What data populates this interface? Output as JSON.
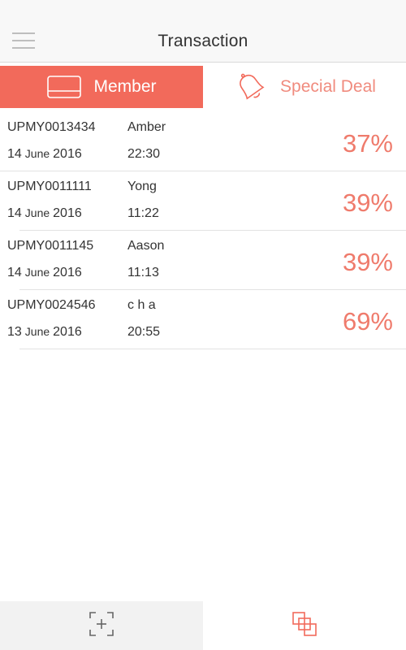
{
  "header": {
    "title": "Transaction"
  },
  "tabs": [
    {
      "label": "Member",
      "icon": "card-icon",
      "active": true
    },
    {
      "label": "Special Deal",
      "icon": "bell-icon",
      "active": false
    }
  ],
  "transactions": [
    {
      "code": "UPMY0013434",
      "name": "Amber",
      "day": "14",
      "month": "June",
      "year": "2016",
      "time": "22:30",
      "percent": "37%"
    },
    {
      "code": "UPMY0011111",
      "name": "Yong",
      "day": "14",
      "month": "June",
      "year": "2016",
      "time": "11:22",
      "percent": "39%"
    },
    {
      "code": "UPMY0011145",
      "name": "Aason",
      "day": "14",
      "month": "June",
      "year": "2016",
      "time": "11:13",
      "percent": "39%"
    },
    {
      "code": "UPMY0024546",
      "name": "c h a",
      "day": "13",
      "month": "June",
      "year": "2016",
      "time": "20:55",
      "percent": "69%"
    }
  ],
  "bottom_bar": [
    {
      "icon": "scan-icon"
    },
    {
      "icon": "overlap-squares-icon"
    }
  ],
  "colors": {
    "accent": "#f26a5b",
    "accent_text": "#ef7b6c",
    "header_bg": "#f8f8f8"
  }
}
